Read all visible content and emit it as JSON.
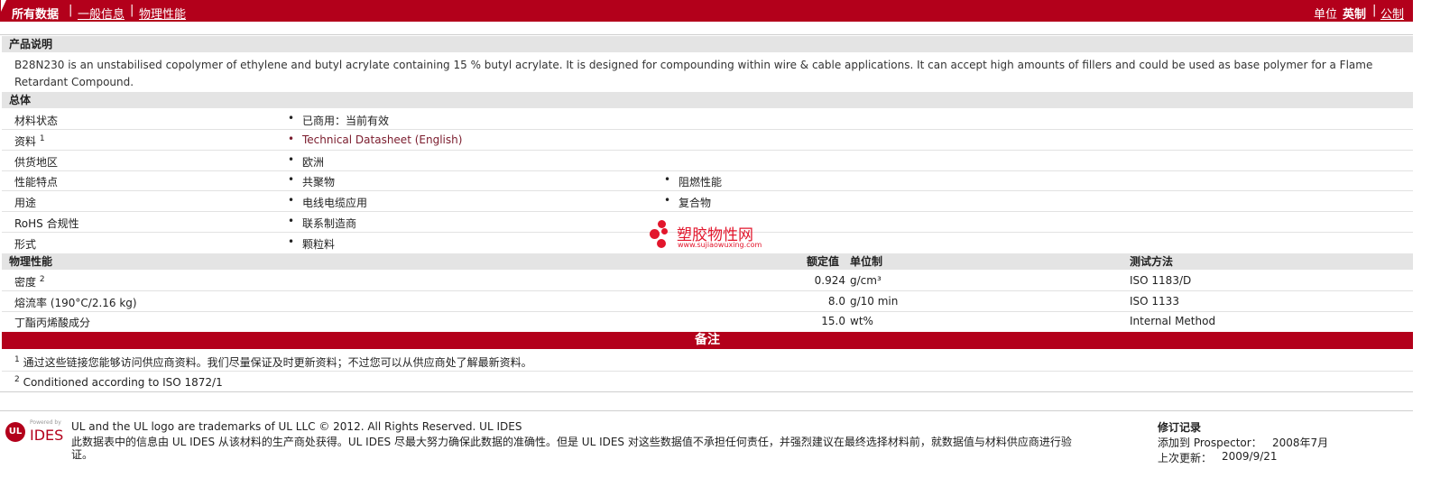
{
  "topbar": {
    "tabs": [
      "所有数据",
      "一般信息",
      "物理性能"
    ],
    "unit_label": "单位",
    "unit_english": "英制",
    "unit_metric": "公制"
  },
  "description": {
    "heading": "产品说明",
    "text": "B28N230 is an unstabilised copolymer of ethylene and butyl acrylate containing 15 % butyl acrylate. It is designed for compounding within wire & cable applications. It can accept high amounts of fillers and could be used as base polymer for a Flame Retardant Compound."
  },
  "general": {
    "heading": "总体",
    "rows": [
      {
        "label": "材料状态",
        "sup": "",
        "values": [
          "已商用：当前有效"
        ]
      },
      {
        "label": "资料",
        "sup": "1",
        "values": [
          "Technical Datasheet (English)"
        ]
      },
      {
        "label": "供货地区",
        "sup": "",
        "values": [
          "欧洲"
        ]
      },
      {
        "label": "性能特点",
        "sup": "",
        "values": [
          "共聚物",
          "阻燃性能"
        ]
      },
      {
        "label": "用途",
        "sup": "",
        "values": [
          "电线电缆应用",
          "复合物"
        ]
      },
      {
        "label": "RoHS 合规性",
        "sup": "",
        "values": [
          "联系制造商"
        ]
      },
      {
        "label": "形式",
        "sup": "",
        "values": [
          "颗粒料"
        ]
      }
    ]
  },
  "physical": {
    "heading": "物理性能",
    "col_nominal": "额定值",
    "col_unit": "单位制",
    "col_method": "测试方法",
    "rows": [
      {
        "label": "密度",
        "sup": "2",
        "value": "0.924",
        "unit": "g/cm³",
        "method": "ISO 1183/D"
      },
      {
        "label": "熔流率 (190°C/2.16 kg)",
        "sup": "",
        "value": "8.0",
        "unit": "g/10 min",
        "method": "ISO 1133"
      },
      {
        "label": "丁酯丙烯酸成分",
        "sup": "",
        "value": "15.0",
        "unit": "wt%",
        "method": "Internal Method"
      }
    ]
  },
  "notes": {
    "heading": "备注",
    "items": [
      {
        "num": "1",
        "text": "通过这些链接您能够访问供应商资料。我们尽量保证及时更新资料；不过您可以从供应商处了解最新资料。"
      },
      {
        "num": "2",
        "text": "Conditioned according to ISO 1872/1"
      }
    ]
  },
  "watermark": {
    "title": "塑胶物性网",
    "url": "www.sujiaowuxing.com"
  },
  "footer": {
    "logo_powered": "Powered by",
    "logo_ul": "UL",
    "logo_ides": "IDES",
    "trademark": "UL and the UL logo are trademarks of UL LLC © 2012. All Rights Reserved. UL IDES",
    "disclaimer_line1": "此数据表中的信息由 UL IDES 从该材料的生产商处获得。UL IDES 尽最大努力确保此数据的准确性。但是 UL IDES 对这些数据值不承担任何责任，并强烈建议在最终选择材料前，就数据值与材料供应商进行验",
    "disclaimer_line2": "证。",
    "revision_heading": "修订记录",
    "added_label": "添加到 Prospector：",
    "added_value": "2008年7月",
    "updated_label": "上次更新：",
    "updated_value": "2009/9/21"
  }
}
